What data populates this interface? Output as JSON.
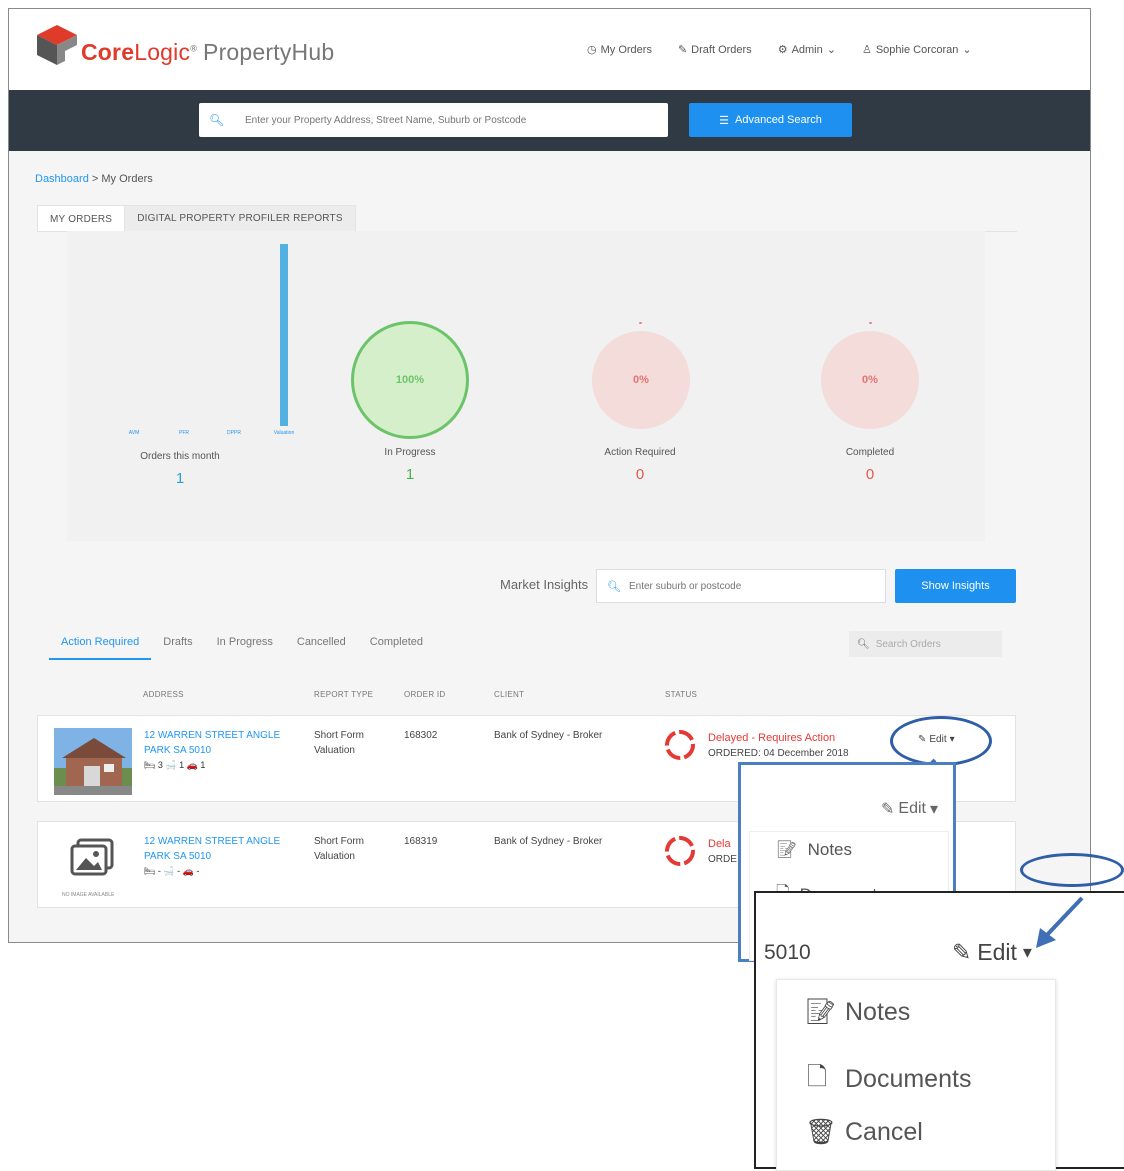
{
  "header": {
    "brand_core": "Core",
    "brand_logic": "Logic",
    "brand_reg": "®",
    "brand_product": "PropertyHub",
    "nav": {
      "my_orders": "My Orders",
      "draft_orders": "Draft Orders",
      "admin": "Admin",
      "user": "Sophie Corcoran"
    }
  },
  "search": {
    "placeholder": "Enter your Property Address, Street Name, Suburb or Postcode",
    "advanced_label": "Advanced Search"
  },
  "breadcrumb": {
    "root": "Dashboard",
    "separator": ">",
    "current": "My Orders"
  },
  "top_tabs": [
    "MY ORDERS",
    "DIGITAL PROPERTY PROFILER REPORTS"
  ],
  "summary": {
    "orders_this_month": {
      "label": "Orders this month",
      "value": "1"
    },
    "in_progress": {
      "label": "In Progress",
      "value": "1",
      "percent": "100%"
    },
    "action_required": {
      "label": "Action Required",
      "value": "0",
      "percent": "0%"
    },
    "completed": {
      "label": "Completed",
      "value": "0",
      "percent": "0%"
    }
  },
  "chart_data": {
    "type": "bar",
    "categories": [
      "AVM",
      "PFR",
      "DPPR",
      "Valuation"
    ],
    "values": [
      0,
      0,
      0,
      1
    ],
    "title": "",
    "xlabel": "",
    "ylabel": "",
    "ylim": [
      0,
      1
    ]
  },
  "market_insights": {
    "label": "Market Insights",
    "placeholder": "Enter suburb or postcode",
    "button": "Show Insights"
  },
  "order_tabs": [
    "Action Required",
    "Drafts",
    "In Progress",
    "Cancelled",
    "Completed"
  ],
  "search_orders_placeholder": "Search Orders",
  "columns": [
    "ADDRESS",
    "REPORT TYPE",
    "ORDER ID",
    "CLIENT",
    "STATUS"
  ],
  "orders": [
    {
      "address_line1": "12 WARREN STREET ANGLE",
      "address_line2": "PARK SA 5010",
      "features": "🛏 3  🛁 1  🚗 1",
      "report_line1": "Short Form",
      "report_line2": "Valuation",
      "order_id": "168302",
      "client": "Bank of Sydney - Broker",
      "status": "Delayed - Requires Action",
      "ordered": "ORDERED: 04 December 2018",
      "edit": "Edit"
    },
    {
      "address_line1": "12 WARREN STREET ANGLE",
      "address_line2": "PARK SA 5010",
      "features": "🛏 -  🛁 -  🚗 -",
      "report_line1": "Short Form",
      "report_line2": "Valuation",
      "order_id": "168319",
      "client": "Bank of Sydney - Broker",
      "status": "Dela",
      "ordered": "ORDE",
      "no_image": "NO IMAGE AVAILABLE"
    }
  ],
  "zoom1": {
    "edit": "Edit",
    "notes": "Notes",
    "documents": "Documents"
  },
  "zoom2": {
    "postcode": "5010",
    "edit": "Edit",
    "notes": "Notes",
    "documents": "Documents",
    "cancel": "Cancel"
  }
}
